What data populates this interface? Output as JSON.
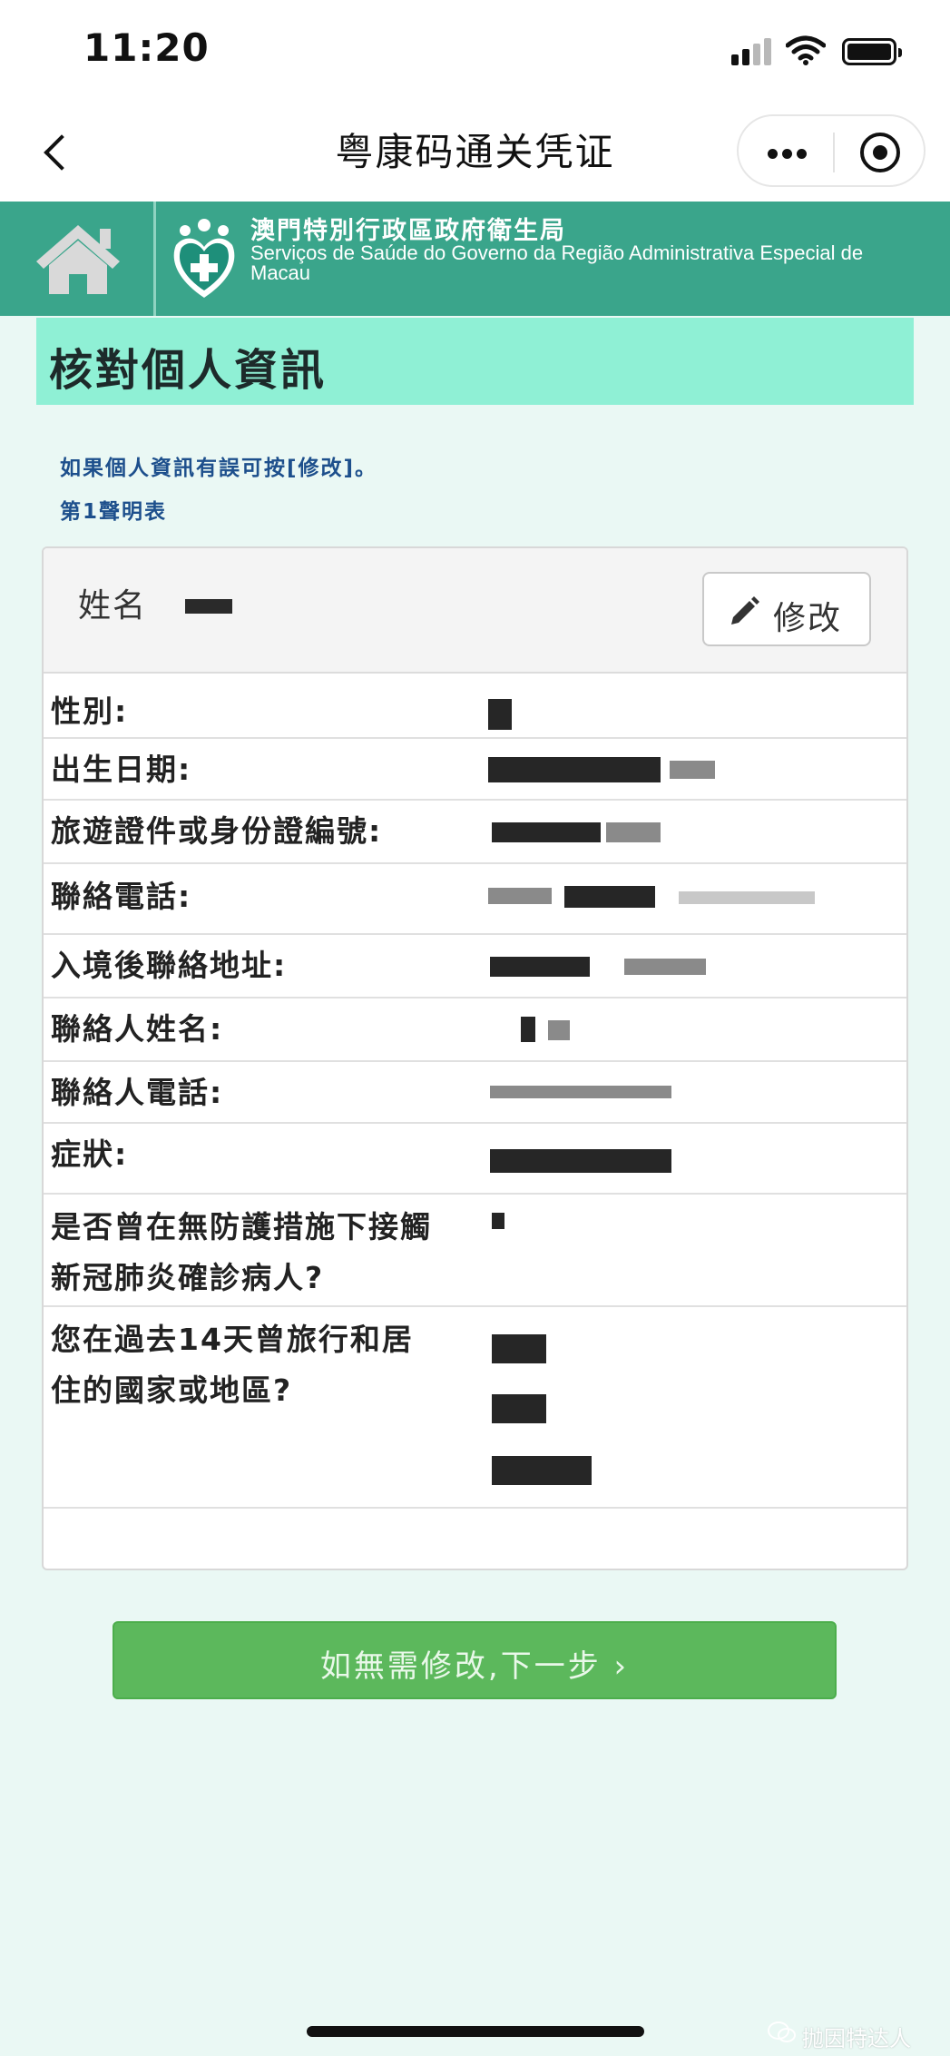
{
  "status_bar": {
    "time": "11:20"
  },
  "nav": {
    "title": "粤康码通关凭证"
  },
  "banner": {
    "org_zh": "澳門特別行政區政府衛生局",
    "org_pt_line1": "Serviços de Saúde do Governo da Região Administrativa Especial de",
    "org_pt_line2": "Macau"
  },
  "page": {
    "heading": "核對個人資訊",
    "hint": "如果個人資訊有誤可按[修改]。",
    "declaration_no": "第1聲明表"
  },
  "card": {
    "name_label": "姓名",
    "edit_label": "修改",
    "rows": [
      {
        "label": "性別:"
      },
      {
        "label": "出生日期:"
      },
      {
        "label": "旅遊證件或身份證編號:"
      },
      {
        "label": "聯絡電話:"
      },
      {
        "label": "入境後聯絡地址:"
      },
      {
        "label": "聯絡人姓名:"
      },
      {
        "label": "聯絡人電話:"
      },
      {
        "label": "症狀:"
      },
      {
        "label_line1": "是否曾在無防護措施下接觸",
        "label_line2": "新冠肺炎確診病人?"
      },
      {
        "label_line1": "您在過去14天曾旅行和居",
        "label_line2": "住的國家或地區?"
      }
    ]
  },
  "actions": {
    "next_label": "如無需修改,下一步 ›"
  },
  "watermark": {
    "text": "抛因特达人"
  },
  "colors": {
    "banner_green": "#3aa58b",
    "heading_mint": "#8ff0d5",
    "page_bg": "#eaf8f4",
    "hint_blue": "#1d4f8c",
    "button_green": "#5cb85c"
  },
  "icons": [
    "back-icon",
    "more-icon",
    "close-mini-icon",
    "home-icon",
    "health-emblem-icon",
    "pencil-icon",
    "signal-icon",
    "wifi-icon",
    "battery-icon",
    "wechat-icon"
  ]
}
